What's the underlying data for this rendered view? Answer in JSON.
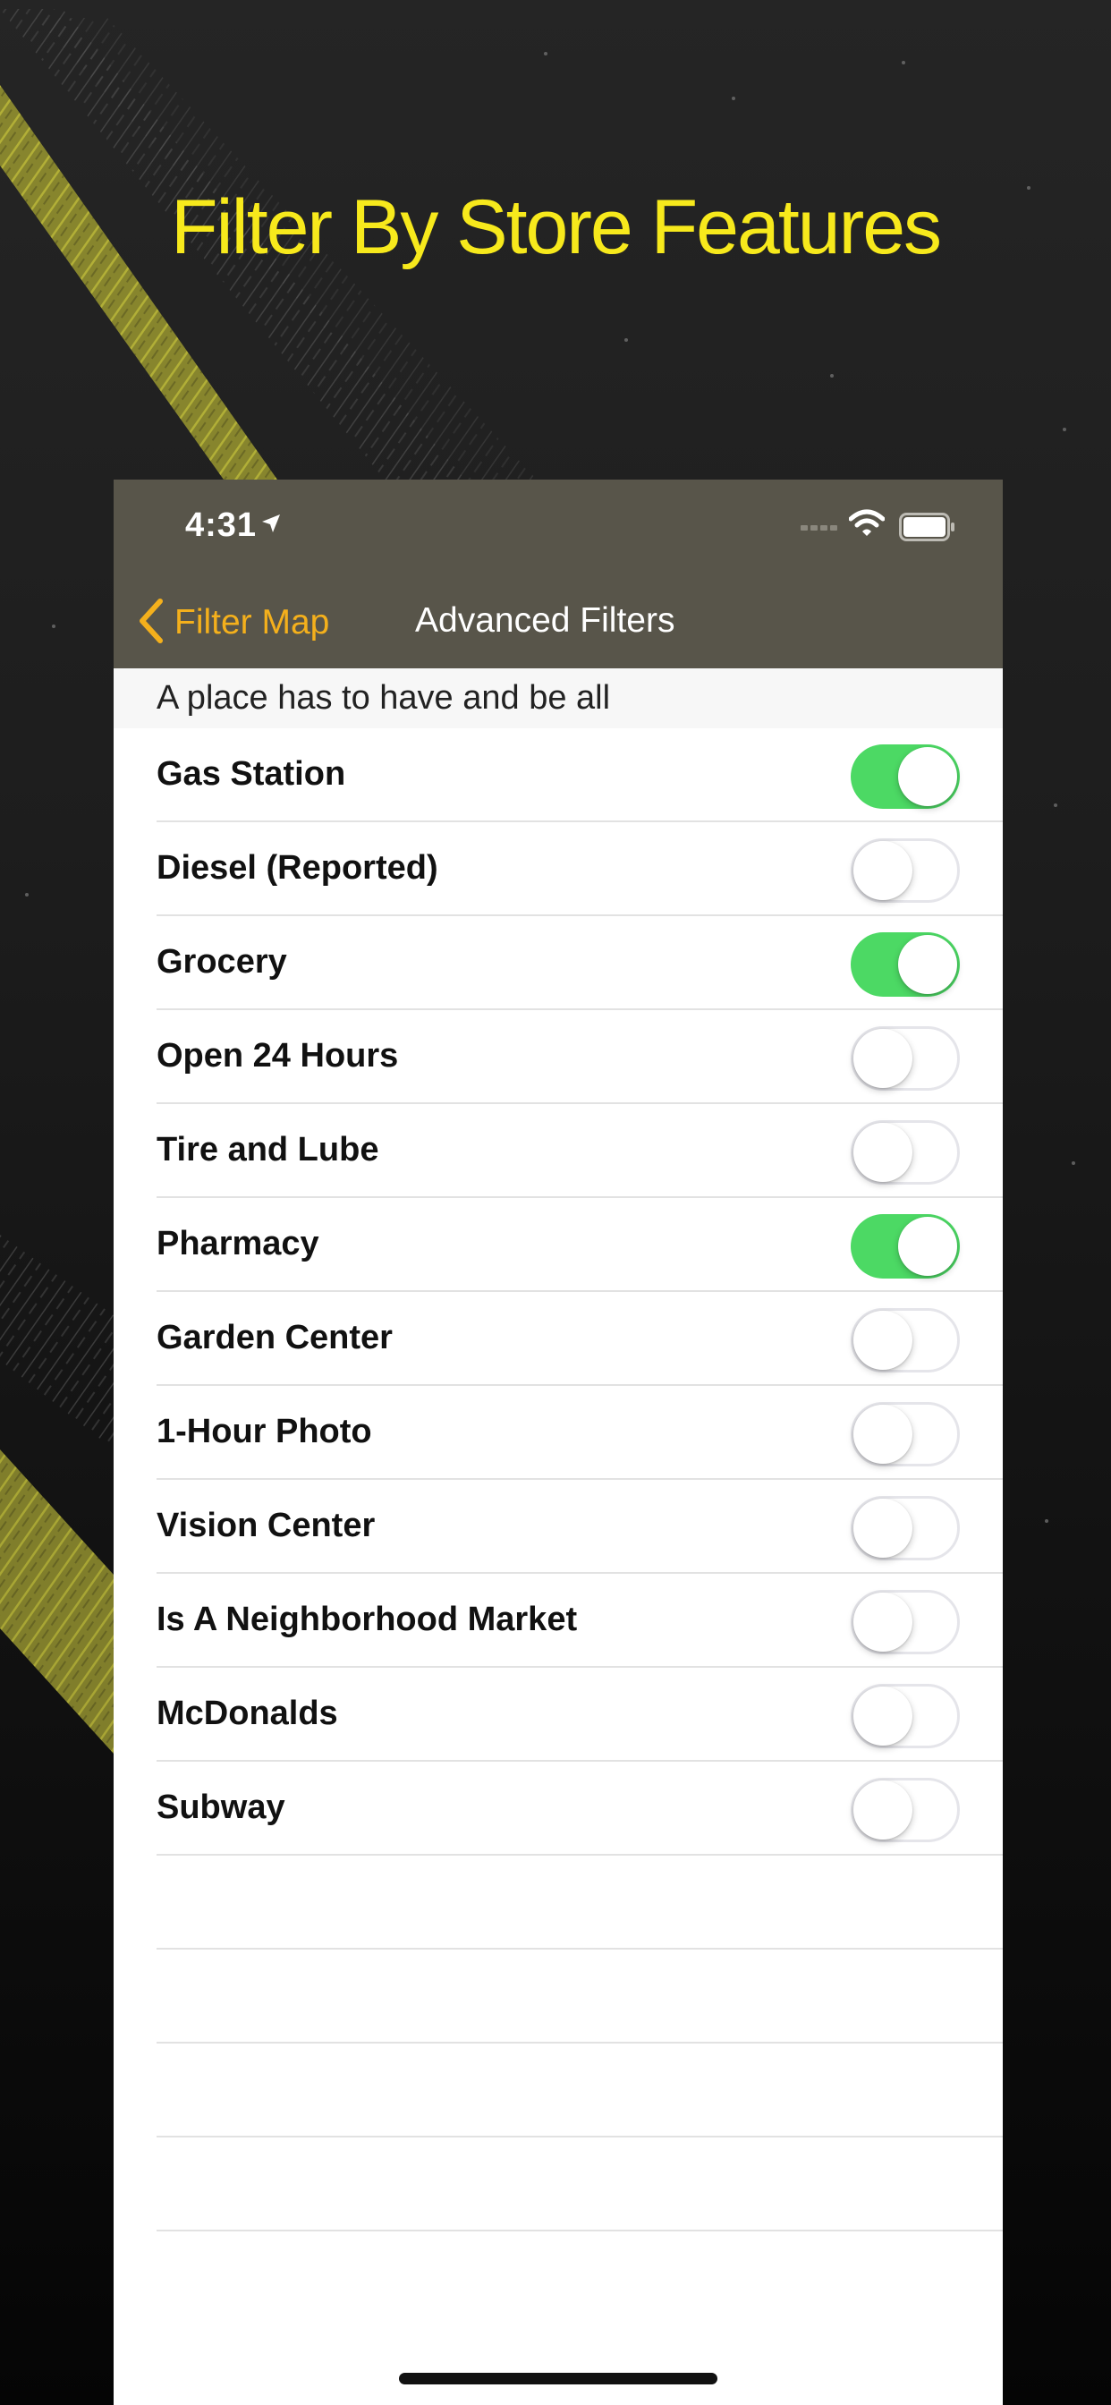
{
  "headline": "Filter By Store Features",
  "status_bar": {
    "time": "4:31"
  },
  "nav": {
    "back_label": "Filter Map",
    "title": "Advanced Filters"
  },
  "section_header": "A place has to have and be all",
  "filters": [
    {
      "label": "Gas Station",
      "on": true
    },
    {
      "label": "Diesel (Reported)",
      "on": false
    },
    {
      "label": "Grocery",
      "on": true
    },
    {
      "label": "Open 24 Hours",
      "on": false
    },
    {
      "label": "Tire and Lube",
      "on": false
    },
    {
      "label": "Pharmacy",
      "on": true
    },
    {
      "label": "Garden Center",
      "on": false
    },
    {
      "label": "1-Hour Photo",
      "on": false
    },
    {
      "label": "Vision Center",
      "on": false
    },
    {
      "label": "Is A Neighborhood Market",
      "on": false
    },
    {
      "label": "McDonalds",
      "on": false
    },
    {
      "label": "Subway",
      "on": false
    }
  ],
  "colors": {
    "headline": "#F7E91C",
    "nav_background": "#58554A",
    "accent": "#F4B01C",
    "toggle_on": "#4CD964"
  }
}
